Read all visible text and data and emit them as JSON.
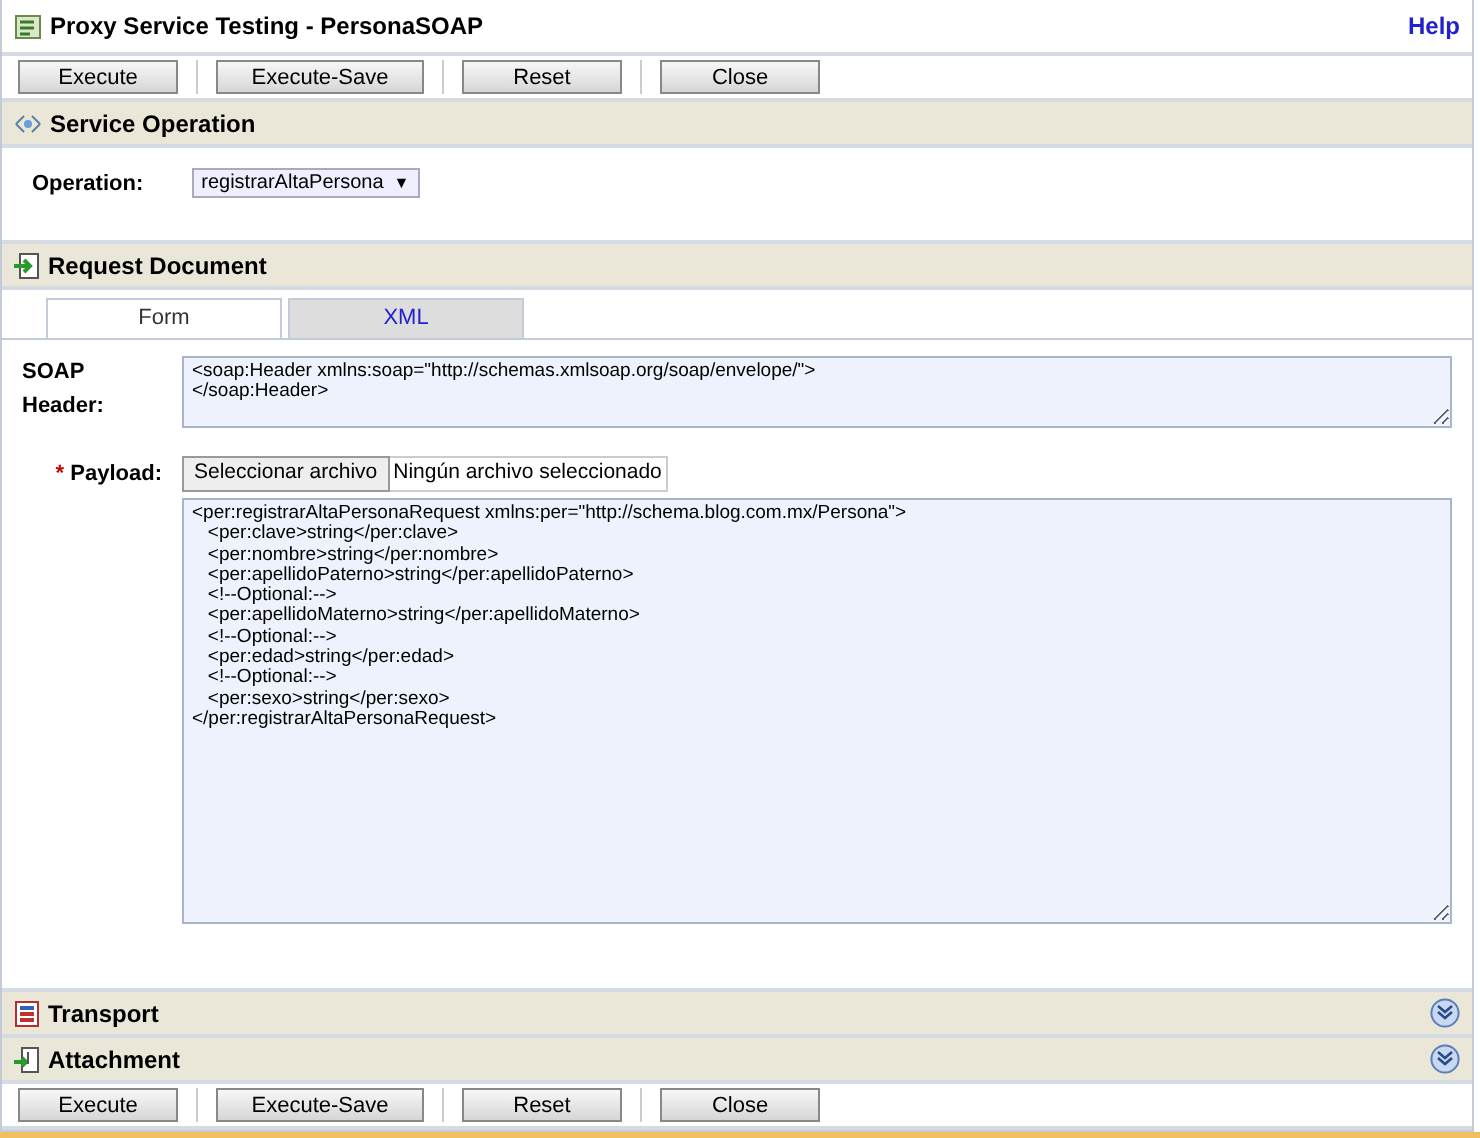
{
  "window": {
    "title": "Proxy Service Testing - PersonaSOAP",
    "help": "Help"
  },
  "toolbar_top": [
    "Execute",
    "Execute-Save",
    "Reset",
    "Close"
  ],
  "service_operation": {
    "title": "Service Operation",
    "operation_label": "Operation:",
    "operation_value": "registrarAltaPersona",
    "dropdown_arrow": "▼"
  },
  "request_document": {
    "title": "Request Document",
    "tabs": [
      {
        "label": "Form",
        "selected": true
      },
      {
        "label": "XML",
        "selected": false
      }
    ],
    "soap_header_label": "SOAP Header:",
    "soap_header": [
      "<soap:Header xmlns:soap=\"http://schemas.xmlsoap.org/soap/envelope/\">",
      "</soap:Header>"
    ],
    "payload_required": "*",
    "payload_label": "Payload:",
    "file_button": "Seleccionar archivo",
    "file_status": "Ningún archivo seleccionado",
    "payload": [
      "<per:registrarAltaPersonaRequest xmlns:per=\"http://schema.blog.com.mx/Persona\">",
      "   <per:clave>string</per:clave>",
      "   <per:nombre>string</per:nombre>",
      "   <per:apellidoPaterno>string</per:apellidoPaterno>",
      "   <!--Optional:-->",
      "   <per:apellidoMaterno>string</per:apellidoMaterno>",
      "   <!--Optional:-->",
      "   <per:edad>string</per:edad>",
      "   <!--Optional:-->",
      "   <per:sexo>string</per:sexo>",
      "</per:registrarAltaPersonaRequest>"
    ]
  },
  "collapsed_sections": [
    {
      "title": "Transport",
      "kind": "transport",
      "expanded": false
    },
    {
      "title": "Attachment",
      "kind": "attachment",
      "expanded": false
    }
  ],
  "toolbar_bottom": [
    "Execute",
    "Execute-Save",
    "Reset",
    "Close"
  ]
}
